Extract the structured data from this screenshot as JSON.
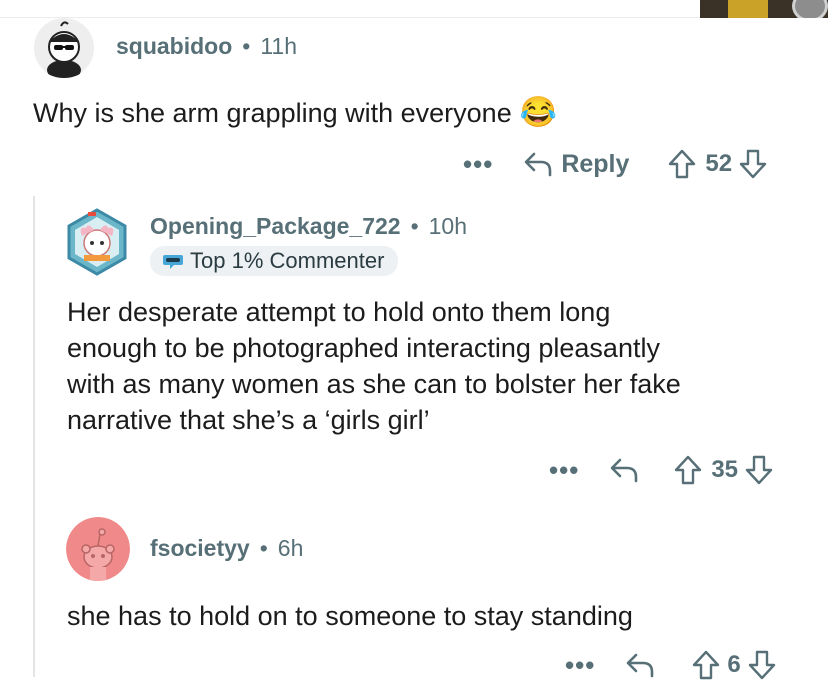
{
  "comments": [
    {
      "username": "squabidoo",
      "separator": "•",
      "time": "11h",
      "text": "Why is she arm grappling with everyone",
      "emoji": "😂",
      "more": "•••",
      "reply_label": "Reply",
      "score": "52"
    },
    {
      "username": "Opening_Package_722",
      "separator": "•",
      "time": "10h",
      "badge": "Top 1% Commenter",
      "text_lines": [
        "Her desperate attempt to hold onto them long",
        "enough to be photographed interacting pleasantly",
        "with as many women as she can to bolster her fake",
        "narrative that she’s a ‘girls girl’"
      ],
      "more": "•••",
      "score": "35"
    },
    {
      "username": "fsocietyy",
      "separator": "•",
      "time": "6h",
      "text": "she has to hold on to someone to stay standing",
      "more": "•••",
      "score": "6"
    }
  ],
  "colors": {
    "meta": "#576f76",
    "text": "#1c1c1c",
    "thread_line": "#e4e4e4",
    "badge_bg": "#eef1f3",
    "avatar3_bg": "#f08989"
  }
}
